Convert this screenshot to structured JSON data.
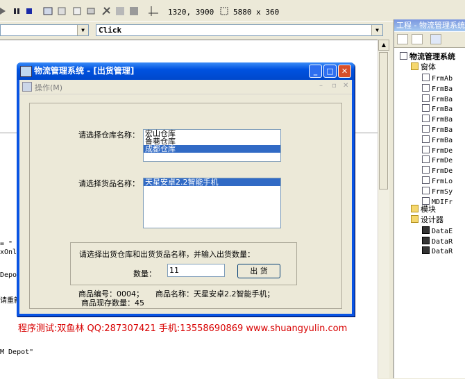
{
  "toolbar": {
    "position": "1320, 3900",
    "size": "5880 x 360"
  },
  "combos": {
    "object_value": "",
    "event_value": "Click"
  },
  "code_lines": [
    "= \"",
    "xOnly",
    "Depot",
    "请重新",
    "M Depot\""
  ],
  "project": {
    "title": "工程 - 物流管理系统",
    "root": "物流管理系统",
    "forms_folder": "窗体",
    "forms": [
      "FrmAb",
      "FrmBa",
      "FrmBa",
      "FrmBa",
      "FrmBa",
      "FrmBa",
      "FrmBa",
      "FrmDe",
      "FrmDe",
      "FrmDe",
      "FrmLo",
      "FrmSy",
      "MDIFr"
    ],
    "modules_folder": "模块",
    "designers_folder": "设计器",
    "designers": [
      "DataE",
      "DataR",
      "DataR"
    ]
  },
  "dialog": {
    "title": "物流管理系统 - [出货管理]",
    "menu_label": "操作(M)",
    "warehouse_label": "请选择仓库名称：",
    "warehouses": [
      "宏山仓库",
      "鲁巷仓库",
      "成都仓库"
    ],
    "selected_warehouse_index": 2,
    "goods_label": "请选择货品名称：",
    "goods": [
      "天星安卓2.2智能手机"
    ],
    "selected_goods_index": 0,
    "group_prompt": "请选择出货仓库和出货货品名称，并输入出货数量：",
    "quantity_label": "数量：",
    "quantity_value": "11",
    "out_button": "出  货",
    "goods_id_text": "商品编号：0004；",
    "goods_name_text": "商品名称：天星安卓2.2智能手机；",
    "stock_text": "商品现存数量：45"
  },
  "footer_text": "程序测试:双鱼林 QQ:287307421 手机:13558690869 www.shuangyulin.com",
  "colors": {
    "xp_title_blue": "#0052e0",
    "selection": "#316ac5",
    "footer_red": "#d80000"
  }
}
